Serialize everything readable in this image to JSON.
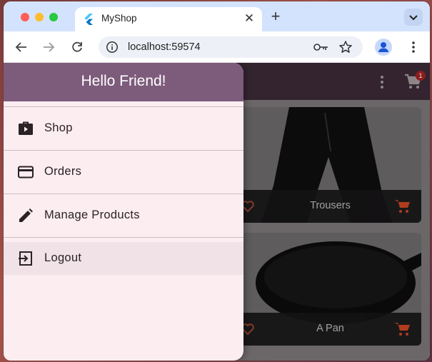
{
  "browser": {
    "tab_title": "MyShop",
    "tab_close_glyph": "✕",
    "new_tab_glyph": "+",
    "url": "localhost:59574",
    "icons": [
      "flutter-favicon-icon",
      "info-icon",
      "key-icon",
      "star-icon",
      "profile-icon",
      "kebab-menu-icon",
      "back-arrow-icon",
      "forward-arrow-icon",
      "reload-icon",
      "chevron-down-icon"
    ]
  },
  "app": {
    "cart_badge": "1",
    "drawer": {
      "title": "Hello Friend!",
      "items": [
        {
          "label": "Shop",
          "icon": "shop-bag-icon"
        },
        {
          "label": "Orders",
          "icon": "credit-card-icon"
        },
        {
          "label": "Manage Products",
          "icon": "edit-pencil-icon"
        },
        {
          "label": "Logout",
          "icon": "logout-icon"
        }
      ]
    },
    "products": [
      {
        "title": "Trousers"
      },
      {
        "title": "A Pan"
      }
    ]
  },
  "colors": {
    "drawer_header": "#7d5b7b",
    "drawer_bg": "#fcedf1",
    "appbar": "#33242f",
    "cart_accent": "#b83a1a"
  }
}
